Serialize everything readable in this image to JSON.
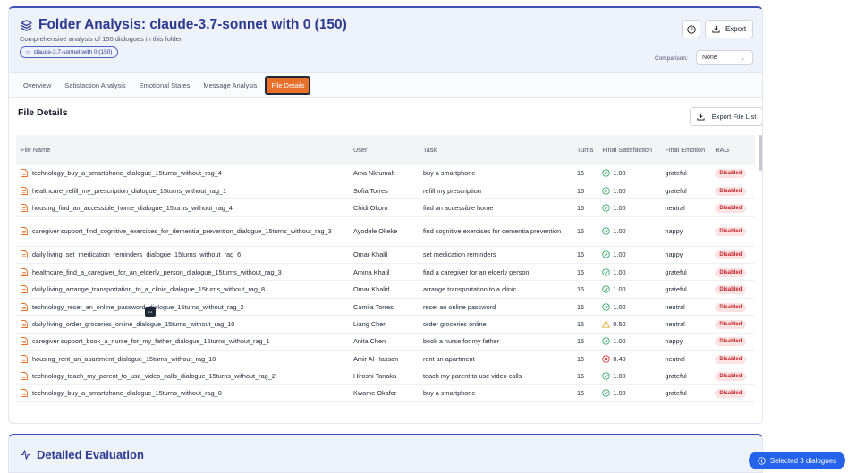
{
  "header": {
    "title": "Folder Analysis: claude-3.7-sonnet with 0 (150)",
    "subtitle": "Comprehensive analysis of 150 dialogues in this folder",
    "chip": "claude-3.7-sonnet with 0 (150)",
    "export_label": "Export",
    "comparison_label": "Comparison:",
    "comparison_value": "None"
  },
  "tabs": [
    {
      "label": "Overview"
    },
    {
      "label": "Satisfaction Analysis"
    },
    {
      "label": "Emotional States"
    },
    {
      "label": "Message Analysis"
    },
    {
      "label": "File Details",
      "active": true
    }
  ],
  "section": {
    "title": "File Details",
    "export_list_label": "Export File List"
  },
  "table": {
    "columns": [
      "File Name",
      "User",
      "Task",
      "Turns",
      "Final Satisfaction",
      "Final Emotion",
      "RAG"
    ],
    "rows": [
      {
        "file": "technology_buy_a_smartphone_dialogue_15turns_without_rag_4",
        "user": "Ama Nkrumah",
        "task": "buy a smartphone",
        "turns": "16",
        "sat": "1.00",
        "status": "good",
        "emotion": "grateful",
        "rag": "Disabled"
      },
      {
        "file": "healthcare_refill_my_prescription_dialogue_15turns_without_rag_1",
        "user": "Sofia Torres",
        "task": "refill my prescription",
        "turns": "16",
        "sat": "1.00",
        "status": "good",
        "emotion": "grateful",
        "rag": "Disabled"
      },
      {
        "file": "housing_find_an_accessible_home_dialogue_15turns_without_rag_4",
        "user": "Chidi Okoro",
        "task": "find an accessible home",
        "turns": "16",
        "sat": "1.00",
        "status": "good",
        "emotion": "neutral",
        "rag": "Disabled"
      },
      {
        "file": "caregiver support_find_cognitive_exercises_for_dementia_prevention_dialogue_15turns_without_rag_3",
        "user": "Ayodele Okeke",
        "task": "find cognitive exercises for dementia prevention",
        "turns": "16",
        "sat": "1.00",
        "status": "good",
        "emotion": "happy",
        "rag": "Disabled",
        "tall": true
      },
      {
        "file": "daily living_set_medication_reminders_dialogue_15turns_without_rag_6",
        "user": "Omar Khalil",
        "task": "set medication reminders",
        "turns": "16",
        "sat": "1.00",
        "status": "good",
        "emotion": "happy",
        "rag": "Disabled"
      },
      {
        "file": "healthcare_find_a_caregiver_for_an_elderly_person_dialogue_15turns_without_rag_3",
        "user": "Amina Khalil",
        "task": "find a caregiver for an elderly person",
        "turns": "16",
        "sat": "1.00",
        "status": "good",
        "emotion": "grateful",
        "rag": "Disabled"
      },
      {
        "file": "daily living_arrange_transportation_to_a_clinic_dialogue_15turns_without_rag_8",
        "user": "Omar Khalid",
        "task": "arrange transportation to a clinic",
        "turns": "16",
        "sat": "1.00",
        "status": "good",
        "emotion": "grateful",
        "rag": "Disabled"
      },
      {
        "file": "technology_reset_an_online_password_dialogue_15turns_without_rag_2",
        "user": "Camila Torres",
        "task": "reset an online password",
        "turns": "16",
        "sat": "1.00",
        "status": "good",
        "emotion": "neutral",
        "rag": "Disabled"
      },
      {
        "file": "daily living_order_groceries_online_dialogue_15turns_without_rag_10",
        "user": "Liang Chen",
        "task": "order groceries online",
        "turns": "16",
        "sat": "0.50",
        "status": "warn",
        "emotion": "neutral",
        "rag": "Disabled"
      },
      {
        "file": "caregiver support_book_a_nurse_for_my_father_dialogue_15turns_without_rag_1",
        "user": "Anita Chen",
        "task": "book a nurse for my father",
        "turns": "16",
        "sat": "1.00",
        "status": "good",
        "emotion": "happy",
        "rag": "Disabled"
      },
      {
        "file": "housing_rent_an_apartment_dialogue_15turns_without_rag_10",
        "user": "Amir Al-Hassan",
        "task": "rent an apartment",
        "turns": "16",
        "sat": "0.40",
        "status": "bad",
        "emotion": "neutral",
        "rag": "Disabled"
      },
      {
        "file": "technology_teach_my_parent_to_use_video_calls_dialogue_15turns_without_rag_2",
        "user": "Hiroshi Tanaka",
        "task": "teach my parent to use video calls",
        "turns": "16",
        "sat": "1.00",
        "status": "good",
        "emotion": "grateful",
        "rag": "Disabled"
      },
      {
        "file": "technology_buy_a_smartphone_dialogue_15turns_without_rag_8",
        "user": "Kwame Okafor",
        "task": "buy a smartphone",
        "turns": "16",
        "sat": "1.00",
        "status": "good",
        "emotion": "grateful",
        "rag": "Disabled"
      }
    ]
  },
  "detail": {
    "title": "Detailed Evaluation"
  },
  "selection": {
    "label": "Selected 3 dialogues"
  },
  "colors": {
    "accent": "#2f3a8f",
    "active_tab": "#e8702a",
    "good": "#22a35a",
    "warn": "#e0a21b",
    "bad": "#dc2626"
  }
}
